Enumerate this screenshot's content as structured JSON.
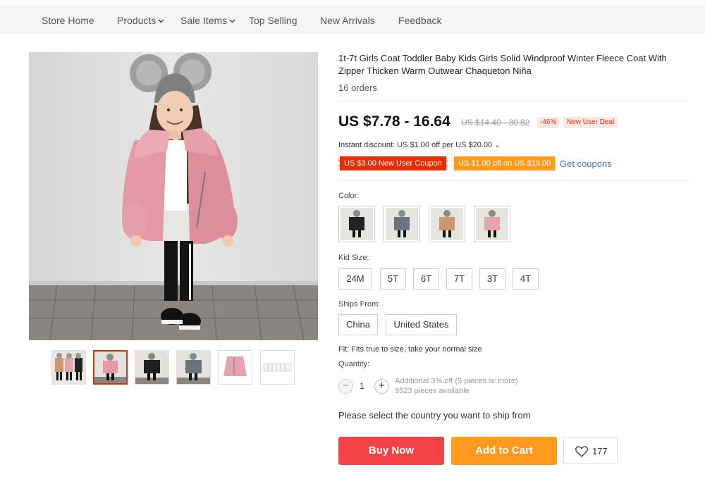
{
  "nav": {
    "items": [
      {
        "label": "Store Home",
        "dropdown": false
      },
      {
        "label": "Products",
        "dropdown": true
      },
      {
        "label": "Sale Items",
        "dropdown": true
      },
      {
        "label": "Top Selling",
        "dropdown": false
      },
      {
        "label": "New Arrivals",
        "dropdown": false
      },
      {
        "label": "Feedback",
        "dropdown": false
      }
    ],
    "chevron": "⌄"
  },
  "gallery": {
    "main_photo": "girl-in-pink-faux-fur-coat-photo",
    "thumbnails": [
      {
        "name": "coat-multi-color-thumb"
      },
      {
        "name": "coat-pink-thumb",
        "selected": true
      },
      {
        "name": "coat-black-thumb"
      },
      {
        "name": "coat-gray-thumb"
      },
      {
        "name": "coat-pink-flatlay-thumb"
      },
      {
        "name": "size-chart-thumb"
      }
    ]
  },
  "product": {
    "title": "1t-7t Girls Coat Toddler Baby Kids Girls Solid Windproof Winter Fleece Coat With Zipper Thicken Warm Outwear Chaqueton Niña",
    "orders": "16 orders",
    "price": "US $7.78 - 16.64",
    "old_price": "US $14.40 - 30.82",
    "discount": "-46%",
    "deal": "New User Deal",
    "instant_discount": "Instant discount: US $1.00 off per US $20.00 ⌄",
    "coupons": [
      "US $3.00 New User Coupon",
      "US $1.00 off on US $19.00"
    ],
    "get_coupons": "Get coupons",
    "color_label": "Color:",
    "colors": [
      "black",
      "gray",
      "camel",
      "pink"
    ],
    "size_label": "Kid Size:",
    "sizes": [
      "24M",
      "5T",
      "6T",
      "7T",
      "3T",
      "4T"
    ],
    "ships_label": "Ships From:",
    "ships_from": [
      "China",
      "United States"
    ],
    "fit": "Fit: Fits true to size, take your normal size",
    "quantity_label": "Quantity:",
    "quantity": "1",
    "quantity_note_1": "Additional 3% off (5 pieces or more)",
    "quantity_note_2": "9523 pieces available",
    "ship_message": "Please select the country you want to ship from",
    "buy_now": "Buy Now",
    "add_to_cart": "Add to Cart",
    "wishlist_count": "177"
  },
  "colors": {
    "accent_red": "#f44346",
    "accent_orange": "#ff9a1f",
    "link_blue": "#3a78c4",
    "coat_black": "#222222",
    "coat_gray": "#6b7280",
    "coat_camel": "#c89872",
    "coat_pink": "#e7a3ad"
  }
}
